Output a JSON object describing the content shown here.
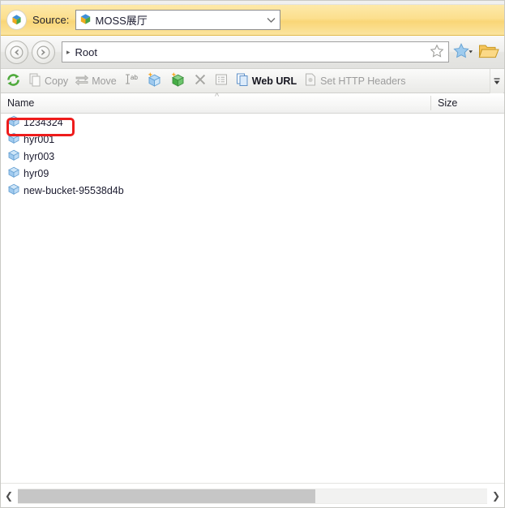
{
  "source_bar": {
    "logo_icon": "app-cube-logo-icon",
    "label": "Source:",
    "selected_value": "MOSS展厅",
    "select_icon": "bucket-cube-icon",
    "chevron_icon": "chevron-down-icon"
  },
  "nav_bar": {
    "back_icon": "back-arrow-icon",
    "forward_icon": "forward-arrow-icon",
    "path_arrow_icon": "path-separator-arrow-icon",
    "breadcrumb": "Root",
    "favorite_outline_icon": "star-outline-icon",
    "favorites_icon": "star-filled-icon",
    "favorites_chevron_icon": "chevron-down-icon",
    "folder_icon": "open-folder-icon"
  },
  "toolbar": {
    "items": [
      {
        "name": "refresh",
        "label": "",
        "icon": "refresh-icon",
        "enabled": true
      },
      {
        "name": "copy",
        "label": "Copy",
        "icon": "copy-icon",
        "enabled": false
      },
      {
        "name": "move",
        "label": "Move",
        "icon": "move-icon",
        "enabled": false
      },
      {
        "name": "rename",
        "label": "",
        "icon": "rename-ab-icon",
        "enabled": false
      },
      {
        "name": "new-bucket",
        "label": "",
        "icon": "new-bucket-blue-icon",
        "enabled": true
      },
      {
        "name": "new-folder",
        "label": "",
        "icon": "new-bucket-green-icon",
        "enabled": true
      },
      {
        "name": "delete",
        "label": "",
        "icon": "delete-x-icon",
        "enabled": false
      },
      {
        "name": "properties",
        "label": "",
        "icon": "properties-list-icon",
        "enabled": false
      },
      {
        "name": "web-url",
        "label": "Web URL",
        "icon": "web-url-icon",
        "enabled": true
      },
      {
        "name": "set-http-headers",
        "label": "Set HTTP Headers",
        "icon": "http-headers-icon",
        "enabled": false
      }
    ],
    "overflow_icon": "toolbar-overflow-chevron-icon"
  },
  "file_list": {
    "columns": [
      {
        "key": "name",
        "label": "Name"
      },
      {
        "key": "size",
        "label": "Size"
      }
    ],
    "sort_indicator": "^",
    "rows": [
      {
        "icon": "bucket-cube-icon",
        "name": "1234324",
        "size": "",
        "annotated": true
      },
      {
        "icon": "bucket-cube-icon",
        "name": "hyr001",
        "size": "",
        "annotated": false
      },
      {
        "icon": "bucket-cube-icon",
        "name": "hyr003",
        "size": "",
        "annotated": false
      },
      {
        "icon": "bucket-cube-icon",
        "name": "hyr09",
        "size": "",
        "annotated": false
      },
      {
        "icon": "bucket-cube-icon",
        "name": "new-bucket-95538d4b",
        "size": "",
        "annotated": false
      }
    ]
  },
  "scrollbar": {
    "left_arrow_icon": "scroll-left-arrow-icon",
    "right_arrow_icon": "scroll-right-arrow-icon"
  },
  "colors": {
    "source_bar": "#fbe49f",
    "annotation": "#ee1c1c",
    "bucket_blue": "#7fb3e8",
    "accent_star": "#8fc4ec"
  }
}
